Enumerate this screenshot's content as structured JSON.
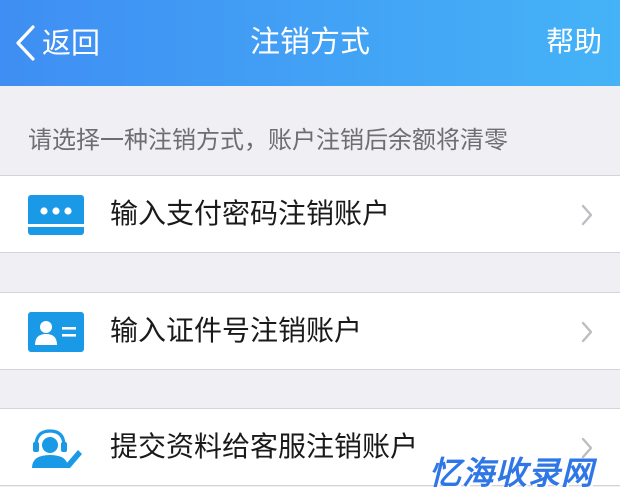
{
  "header": {
    "back_label": "返回",
    "title": "注销方式",
    "help_label": "帮助"
  },
  "hint": "请选择一种注销方式，账户注销后余额将清零",
  "options": [
    {
      "label": "输入支付密码注销账户",
      "icon": "password-card-icon"
    },
    {
      "label": "输入证件号注销账户",
      "icon": "id-card-icon"
    },
    {
      "label": "提交资料给客服注销账户",
      "icon": "customer-service-icon"
    }
  ],
  "watermark": "忆海收录网",
  "colors": {
    "header_gradient_start": "#3f8ef3",
    "header_gradient_end": "#45b3f7",
    "icon_accent": "#1a9ae6",
    "page_background": "#efeff4"
  }
}
